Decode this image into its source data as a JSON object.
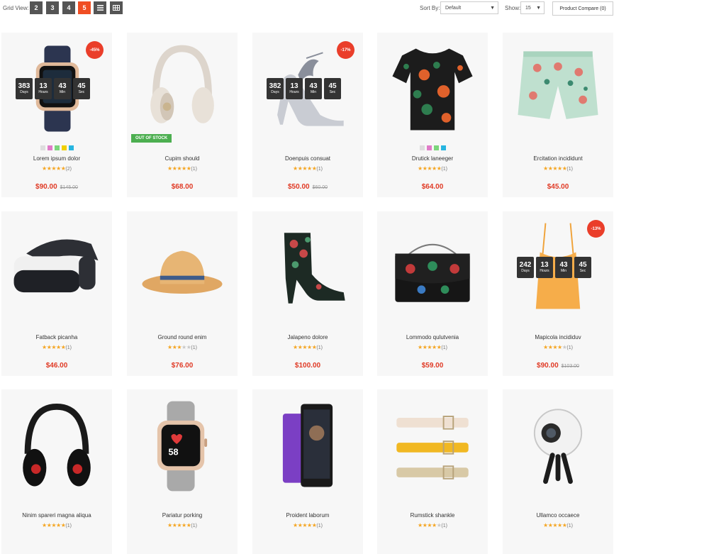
{
  "toolbar": {
    "grid_view_label": "Grid View:",
    "grid_options": [
      "2",
      "3",
      "4",
      "5"
    ],
    "grid_active": "5",
    "list_icon": "list-icon",
    "table_icon": "table-icon",
    "sort_label": "Sort By:",
    "sort_value": "Default",
    "show_label": "Show:",
    "show_value": "15",
    "compare_label": "Product Compare (0)"
  },
  "colors": {
    "accent": "#f04e23",
    "price": "#e03a25",
    "star": "#f5a623",
    "out_of_stock": "#4caf50",
    "grid_button": "#555555"
  },
  "countdown_labels": {
    "days": "Days",
    "hours": "Hours",
    "min": "Min",
    "sec": "Sec"
  },
  "products": [
    {
      "name": "Lorem ipsum dolor",
      "rating": 5,
      "reviews": "(2)",
      "price": "$90.00",
      "old_price": "$145.00",
      "badge": "-45%",
      "countdown": {
        "days": "383",
        "hours": "13",
        "min": "43",
        "sec": "45"
      },
      "swatches": [
        "#dddddd",
        "#e07bc8",
        "#7cd67c",
        "#f0d000",
        "#27b5e0"
      ],
      "image_icon": "smartwatch-icon"
    },
    {
      "name": "Cupim should",
      "rating": 5,
      "reviews": "(1)",
      "price": "$68.00",
      "out_of_stock": "OUT OF STOCK",
      "image_icon": "headphones-icon"
    },
    {
      "name": "Doenpuis consuat",
      "rating": 5,
      "reviews": "(1)",
      "price": "$50.00",
      "old_price": "$60.00",
      "badge": "-17%",
      "countdown": {
        "days": "382",
        "hours": "13",
        "min": "43",
        "sec": "45"
      },
      "image_icon": "high-heel-shoe-icon"
    },
    {
      "name": "Drutick laneeger",
      "rating": 5,
      "reviews": "(1)",
      "price": "$64.00",
      "swatches": [
        "#dddddd",
        "#e07bc8",
        "#7cd67c",
        "#27b5e0"
      ],
      "image_icon": "tshirt-icon"
    },
    {
      "name": "Ercitation incididunt",
      "rating": 5,
      "reviews": "(1)",
      "price": "$45.00",
      "image_icon": "shorts-icon"
    },
    {
      "name": "Fatback picanha",
      "rating": 5,
      "reviews": "(1)",
      "price": "$46.00",
      "image_icon": "vr-headset-icon"
    },
    {
      "name": "Ground round enim",
      "rating": 3,
      "reviews": "(1)",
      "price": "$76.00",
      "image_icon": "hat-icon"
    },
    {
      "name": "Jalapeno dolore",
      "rating": 5,
      "reviews": "(1)",
      "price": "$100.00",
      "image_icon": "ankle-boot-icon"
    },
    {
      "name": "Lommodo qulutvenia",
      "rating": 5,
      "reviews": "(1)",
      "price": "$59.00",
      "image_icon": "handbag-icon"
    },
    {
      "name": "Mapicola incididuv",
      "rating": 4,
      "reviews": "(1)",
      "price": "$90.00",
      "old_price": "$103.00",
      "badge": "-13%",
      "countdown": {
        "days": "242",
        "hours": "13",
        "min": "43",
        "sec": "45"
      },
      "image_icon": "camisole-icon"
    },
    {
      "name": "Ninim spareri magna aliqua",
      "rating": 5,
      "reviews": "(1)",
      "price": "",
      "image_icon": "headphones-icon"
    },
    {
      "name": "Pariatur porking",
      "rating": 5,
      "reviews": "(1)",
      "price": "",
      "image_icon": "smartwatch-icon"
    },
    {
      "name": "Proident laborum",
      "rating": 5,
      "reviews": "(1)",
      "price": "",
      "image_icon": "smartphone-icon"
    },
    {
      "name": "Rumstick shankle",
      "rating": 4,
      "reviews": "(1)",
      "price": "",
      "image_icon": "belts-icon"
    },
    {
      "name": "Ullamco occaece",
      "rating": 5,
      "reviews": "(1)",
      "price": "",
      "image_icon": "360-camera-icon"
    }
  ]
}
